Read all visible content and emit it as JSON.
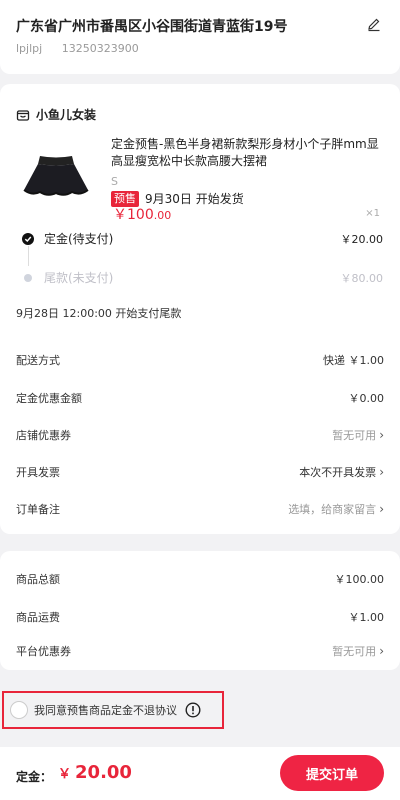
{
  "address": {
    "title": "广东省广州市番禺区小谷围街道青蓝街19号",
    "name": "lpjlpj",
    "phone": "13250323900"
  },
  "shop": {
    "name": "小鱼儿女装"
  },
  "product": {
    "title": "定金预售-黑色半身裙新款梨形身材小个子胖mm显高显瘦宽松中长款高腰大摆裙",
    "spec": "S",
    "presale_badge": "预售",
    "ship_text": "9月30日 开始发货",
    "price_currency": "￥",
    "price_int": "100",
    "price_dec": ".00",
    "qty": "×1"
  },
  "steps": [
    {
      "label": "定金(待支付)",
      "amount": "￥20.00"
    },
    {
      "label": "尾款(未支付)",
      "amount": "￥80.00"
    }
  ],
  "tail_note": "9月28日 12:00:00 开始支付尾款",
  "options": [
    {
      "label": "配送方式",
      "value": "快递 ￥1.00"
    },
    {
      "label": "定金优惠金额",
      "value": "￥0.00"
    },
    {
      "label": "店铺优惠券",
      "value": "暂无可用"
    },
    {
      "label": "开具发票",
      "value": "本次不开具发票"
    },
    {
      "label": "订单备注",
      "value": "选填，给商家留言"
    }
  ],
  "totals": [
    {
      "label": "商品总额",
      "value": "￥100.00"
    },
    {
      "label": "商品运费",
      "value": "￥1.00"
    },
    {
      "label": "平台优惠券",
      "value": "暂无可用"
    }
  ],
  "agreement": {
    "text": "我同意预售商品定金不退协议"
  },
  "footer": {
    "total_label": "定金：",
    "currency": "￥",
    "total_value": "20.00",
    "submit": "提交订单"
  },
  "colors": {
    "accent": "#e8253a",
    "button": "#ef2444"
  }
}
